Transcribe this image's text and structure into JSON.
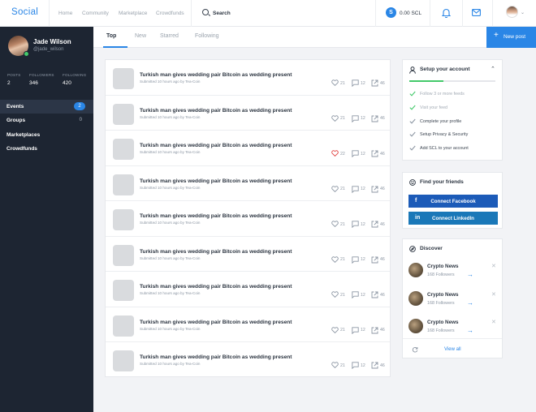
{
  "topbar": {
    "brand": "Social",
    "nav": [
      "Home",
      "Community",
      "Marketplace",
      "Crowdfunds"
    ],
    "search_label": "Search",
    "coin_symbol": "S",
    "balance": "0.00 SCL",
    "accent": "#2a86e6"
  },
  "profile": {
    "name": "Jade Wilson",
    "handle": "@jade_wilson",
    "stats": [
      {
        "label": "POSTS",
        "value": "2"
      },
      {
        "label": "FOLLOWERS",
        "value": "346"
      },
      {
        "label": "FOLLOWING",
        "value": "420"
      }
    ]
  },
  "sidebar": {
    "items": [
      {
        "label": "Events",
        "count": "2",
        "active": true
      },
      {
        "label": "Groups",
        "count": "0",
        "active": false
      },
      {
        "label": "Marketplaces",
        "count": "",
        "active": false
      },
      {
        "label": "Crowdfunds",
        "count": "",
        "active": false
      }
    ]
  },
  "tabs": [
    "Top",
    "New",
    "Starred",
    "Following"
  ],
  "new_post_label": "New post",
  "feed": {
    "posts": [
      {
        "title": "Turkish man gives wedding pair Bitcoin as wedding present",
        "meta": "Submitted 10 hours ago by Tea-Coin",
        "likes": "21",
        "comments": "12",
        "shares": "46",
        "liked": false
      },
      {
        "title": "Turkish man gives wedding pair Bitcoin as wedding present",
        "meta": "Submitted 10 hours ago by Tea-Coin",
        "likes": "21",
        "comments": "12",
        "shares": "46",
        "liked": false
      },
      {
        "title": "Turkish man gives wedding pair Bitcoin as wedding present",
        "meta": "Submitted 10 hours ago by Tea-Coin",
        "likes": "22",
        "comments": "12",
        "shares": "46",
        "liked": true
      },
      {
        "title": "Turkish man gives wedding pair Bitcoin as wedding present",
        "meta": "Submitted 10 hours ago by Tea-Coin",
        "likes": "21",
        "comments": "12",
        "shares": "46",
        "liked": false
      },
      {
        "title": "Turkish man gives wedding pair Bitcoin as wedding present",
        "meta": "Submitted 10 hours ago by Tea-Coin",
        "likes": "21",
        "comments": "12",
        "shares": "46",
        "liked": false
      },
      {
        "title": "Turkish man gives wedding pair Bitcoin as wedding present",
        "meta": "Submitted 10 hours ago by Tea-Coin",
        "likes": "21",
        "comments": "12",
        "shares": "46",
        "liked": false
      },
      {
        "title": "Turkish man gives wedding pair Bitcoin as wedding present",
        "meta": "Submitted 10 hours ago by Tea-Coin",
        "likes": "21",
        "comments": "12",
        "shares": "46",
        "liked": false
      },
      {
        "title": "Turkish man gives wedding pair Bitcoin as wedding present",
        "meta": "Submitted 10 hours ago by Tea-Coin",
        "likes": "21",
        "comments": "12",
        "shares": "46",
        "liked": false
      },
      {
        "title": "Turkish man gives wedding pair Bitcoin as wedding present",
        "meta": "Submitted 10 hours ago by Tea-Coin",
        "likes": "21",
        "comments": "12",
        "shares": "46",
        "liked": false
      }
    ]
  },
  "setup": {
    "title": "Setup your account",
    "progress": 0.4,
    "items": [
      {
        "label": "Follow 3 or more feeds",
        "done": true
      },
      {
        "label": "Visit your feed",
        "done": true
      },
      {
        "label": "Complete your profile",
        "done": false
      },
      {
        "label": "Setup Privacy & Security",
        "done": false
      },
      {
        "label": "Add SCL to your account",
        "done": false
      }
    ]
  },
  "friends": {
    "title": "Find your friends",
    "facebook": {
      "icon": "f",
      "label": "Connect Facebook",
      "color": "#1c5bb8"
    },
    "linkedin": {
      "icon": "in",
      "label": "Connect LinkedIn",
      "color": "#1a78b8"
    }
  },
  "discover": {
    "title": "Discover",
    "items": [
      {
        "name": "Crypto News",
        "followers": "168 Followers"
      },
      {
        "name": "Crypto News",
        "followers": "168 Followers"
      },
      {
        "name": "Crypto News",
        "followers": "168 Followers"
      }
    ],
    "view_all": "View all"
  }
}
